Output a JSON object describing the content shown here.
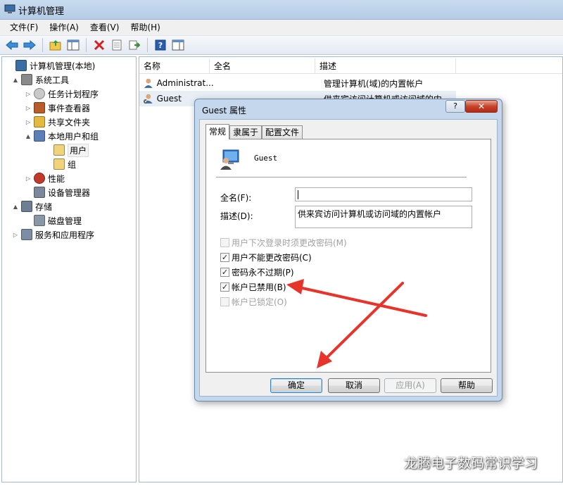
{
  "window": {
    "title": "计算机管理"
  },
  "menu": {
    "items": [
      "文件(F)",
      "操作(A)",
      "查看(V)",
      "帮助(H)"
    ]
  },
  "toolbar": {
    "buttons": [
      "back-arrow-icon",
      "forward-arrow-icon",
      "up-folder-icon",
      "show-tree-icon",
      "delete-icon",
      "properties-icon",
      "export-icon",
      "help-icon",
      "action-pane-icon"
    ]
  },
  "tree": {
    "items": [
      {
        "label": "计算机管理(本地)",
        "icon": "computer-management-icon",
        "expander": "",
        "level": 0
      },
      {
        "label": "系统工具",
        "icon": "tools-icon",
        "expander": "▲",
        "level": 1
      },
      {
        "label": "任务计划程序",
        "icon": "clock-icon",
        "expander": "▷",
        "level": 2
      },
      {
        "label": "事件查看器",
        "icon": "event-viewer-icon",
        "expander": "▷",
        "level": 2
      },
      {
        "label": "共享文件夹",
        "icon": "shared-folder-icon",
        "expander": "▷",
        "level": 2
      },
      {
        "label": "本地用户和组",
        "icon": "users-groups-icon",
        "expander": "▲",
        "level": 2
      },
      {
        "label": "用户",
        "icon": "folder-icon",
        "expander": "",
        "level": 3,
        "selected": true
      },
      {
        "label": "组",
        "icon": "folder-icon",
        "expander": "",
        "level": 3
      },
      {
        "label": "性能",
        "icon": "performance-icon",
        "expander": "▷",
        "level": 2
      },
      {
        "label": "设备管理器",
        "icon": "device-manager-icon",
        "expander": "",
        "level": 2
      },
      {
        "label": "存储",
        "icon": "storage-icon",
        "expander": "▲",
        "level": 1
      },
      {
        "label": "磁盘管理",
        "icon": "disk-icon",
        "expander": "",
        "level": 2
      },
      {
        "label": "服务和应用程序",
        "icon": "services-icon",
        "expander": "▷",
        "level": 1
      }
    ]
  },
  "list": {
    "columns": [
      "名称",
      "全名",
      "描述"
    ],
    "rows": [
      {
        "name": "Administrat...",
        "fullname": "",
        "description": "管理计算机(域)的内置帐户"
      },
      {
        "name": "Guest",
        "fullname": "",
        "description": "供来宾访问计算机或访问域的内..."
      }
    ]
  },
  "dialog": {
    "title": "Guest 属性",
    "help_label": "?",
    "close_label": "✕",
    "tabs": [
      "常规",
      "隶属于",
      "配置文件"
    ],
    "active_tab": 0,
    "user_name": "Guest",
    "fullname_label": "全名(F):",
    "fullname_value": "",
    "description_label": "描述(D):",
    "description_value": "供来宾访问计算机或访问域的内置帐户",
    "checkboxes": [
      {
        "label": "用户下次登录时须更改密码(M)",
        "checked": false,
        "disabled": true
      },
      {
        "label": "用户不能更改密码(C)",
        "checked": true,
        "disabled": false
      },
      {
        "label": "密码永不过期(P)",
        "checked": true,
        "disabled": false
      },
      {
        "label": "帐户已禁用(B)",
        "checked": true,
        "disabled": false
      },
      {
        "label": "帐户已锁定(O)",
        "checked": false,
        "disabled": true
      }
    ],
    "buttons": {
      "ok": "确定",
      "cancel": "取消",
      "apply": "应用(A)",
      "help": "帮助"
    }
  },
  "annotation": {
    "arrow_color": "#e8332b"
  },
  "watermark": {
    "text": "龙腾电子数码常识学习"
  }
}
